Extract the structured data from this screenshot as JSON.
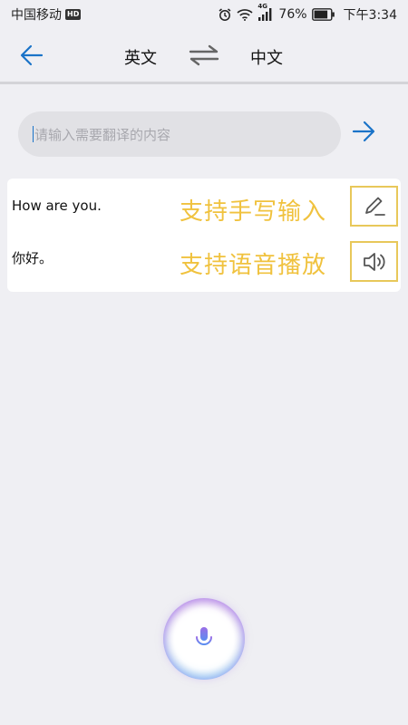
{
  "status_bar": {
    "carrier": "中国移动",
    "hd_badge": "HD",
    "network": "4G",
    "battery": "76%",
    "time": "下午3:34"
  },
  "header": {
    "source_lang": "英文",
    "target_lang": "中文"
  },
  "input": {
    "placeholder": "请输入需要翻译的内容"
  },
  "result": {
    "source_text": "How are you.",
    "target_text": "你好。",
    "annotation_handwrite": "支持手写输入",
    "annotation_voice": "支持语音播放"
  },
  "colors": {
    "accent": "#1a73c8",
    "annotation": "#f0c23e",
    "background": "#efeff3"
  },
  "icons": {
    "back": "arrow-left-icon",
    "swap": "swap-icon",
    "send": "arrow-right-icon",
    "edit": "pencil-icon",
    "speaker": "speaker-icon",
    "mic": "microphone-icon"
  }
}
